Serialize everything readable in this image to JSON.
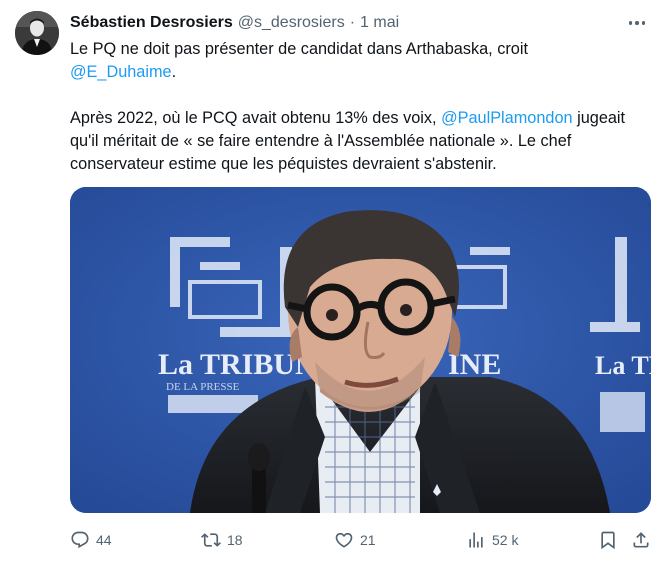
{
  "tweet": {
    "author": {
      "name": "Sébastien Desrosiers",
      "handle": "@s_desrosiers",
      "separator": "·",
      "date": "1 mai"
    },
    "text": {
      "line1_pre": "Le PQ ne doit pas présenter de candidat dans Arthabaska, croit",
      "mention1": "@E_Duhaime",
      "line1_post": ".",
      "para2_pre": "Après 2022, où le PCQ avait obtenu 13% des voix, ",
      "mention2": "@PaulPlamondon",
      "para2_post": " jugeait qu'il méritait de « se faire entendre à l'Assemblée nationale ». Le chef conservateur estime que les péquistes devraient s'abstenir."
    },
    "media": {
      "backdrop_text_left": "La TRIBUNE",
      "backdrop_text_right": "La TRIB",
      "backdrop_subtext": "DE LA PRESSE"
    },
    "actions": {
      "replies": "44",
      "reposts": "18",
      "likes": "21",
      "views": "52 k"
    },
    "icons": [
      "more-icon",
      "reply-icon",
      "repost-icon",
      "like-icon",
      "views-icon",
      "bookmark-icon",
      "share-icon"
    ],
    "colors": {
      "text": "#0f1419",
      "secondary": "#536471",
      "link": "#1d9bf0",
      "backdrop_blue": "#2f57a8"
    }
  }
}
